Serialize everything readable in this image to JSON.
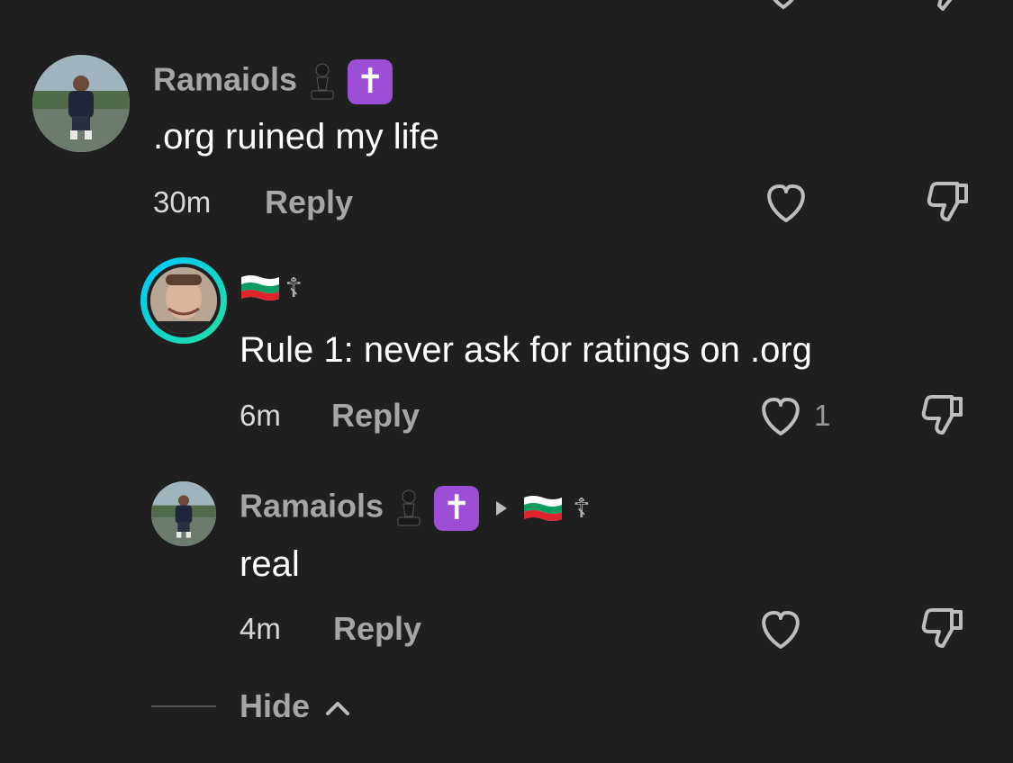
{
  "comments": [
    {
      "author": "Ramaiols",
      "author_badge": "✝",
      "text": ".org ruined my life",
      "time": "30m",
      "reply_label": "Reply",
      "likes": ""
    },
    {
      "author": "",
      "author_symbol": "☦",
      "text": "Rule 1: never ask for ratings on .org",
      "time": "6m",
      "reply_label": "Reply",
      "likes": "1"
    },
    {
      "author": "Ramaiols",
      "author_badge": "✝",
      "reply_to_symbol": "☦",
      "text": "real",
      "time": "4m",
      "reply_label": "Reply",
      "likes": ""
    }
  ],
  "footer": {
    "hide_label": "Hide"
  },
  "colors": {
    "background": "#1f1f1f",
    "accent_badge": "#9c4fd6",
    "story_ring_start": "#00c8ff",
    "story_ring_end": "#22e0a0"
  },
  "icons": [
    "heart-icon",
    "dislike-icon",
    "chess-pawn-icon",
    "cross-badge-icon",
    "bulgaria-flag-icon",
    "orthodox-cross-icon",
    "reply-arrow-icon",
    "chevron-up-icon"
  ]
}
